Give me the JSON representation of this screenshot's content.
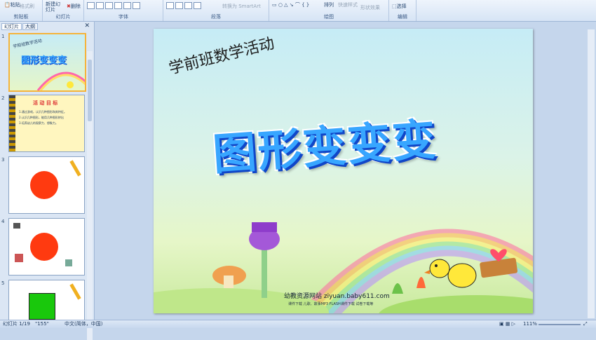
{
  "ribbon": {
    "clipboard": {
      "paste": "粘贴",
      "format_painter": "格式刷",
      "label": "剪贴板"
    },
    "slides": {
      "new_slide": "新建幻灯片",
      "delete": "删除",
      "label": "幻灯片"
    },
    "font": {
      "label": "字体"
    },
    "paragraph": {
      "convert_smartart": "转换为 SmartArt",
      "label": "段落"
    },
    "drawing": {
      "arrange": "排列",
      "quick_styles": "快速样式",
      "shape_effects": "形状效果",
      "label": "绘图"
    },
    "editing": {
      "select": "选择",
      "label": "编辑"
    }
  },
  "left_panel": {
    "tabs": [
      "幻灯片",
      "大纲"
    ],
    "close": "✕",
    "thumbnails": [
      {
        "num": "1",
        "title": "学前班数学活动",
        "big": "图形变变变"
      },
      {
        "num": "2",
        "title": "活 动 目 标",
        "lines": [
          "1.通过游戏，认识几种图形和其特征。",
          "2.认识几种图形，能用几种图形拼出",
          "3.培养幼儿的观察力、想象力。"
        ]
      },
      {
        "num": "3"
      },
      {
        "num": "4"
      },
      {
        "num": "5"
      }
    ]
  },
  "slide": {
    "title": "学前班数学活动",
    "big_title": "图形变变变",
    "website": "幼教资源网站  ziyuan.baby611.com",
    "footer_links": "课件下载   儿歌、故事MP3   FLASH课件下载   试卷下载等"
  },
  "status": {
    "slide_count": "幻灯片 1/19",
    "theme": "\"155\"",
    "language": "中文(简体，中国)",
    "zoom": "111%"
  },
  "colors": {
    "ribbon_bg": "#dbe7f6",
    "accent": "#f5b33b",
    "title_blue": "#38a6ff"
  }
}
